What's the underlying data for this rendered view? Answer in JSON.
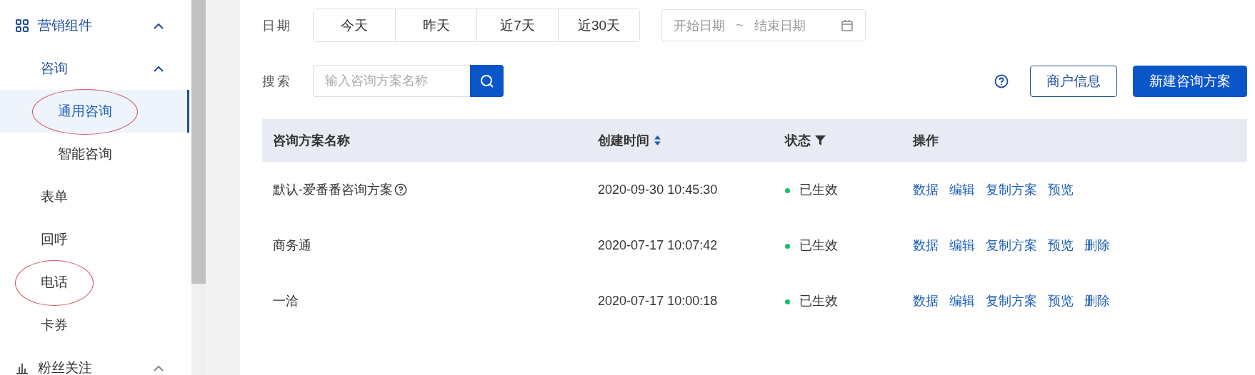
{
  "sidebar": {
    "items": [
      {
        "label": "营销组件",
        "expanded": true,
        "selected": false,
        "circled": false,
        "children": [
          {
            "label": "咨询",
            "expanded": true,
            "selected": false,
            "circled": false,
            "children": [
              {
                "label": "通用咨询",
                "selected": true,
                "circled": true
              },
              {
                "label": "智能咨询",
                "selected": false,
                "circled": false
              }
            ]
          },
          {
            "label": "表单",
            "selected": false,
            "circled": false
          },
          {
            "label": "回呼",
            "selected": false,
            "circled": false
          },
          {
            "label": "电话",
            "selected": false,
            "circled": true
          },
          {
            "label": "卡券",
            "selected": false,
            "circled": false
          }
        ]
      },
      {
        "label": "粉丝关注",
        "expanded": true,
        "selected": false,
        "circled": false
      }
    ]
  },
  "filters": {
    "date_label": "日期",
    "date_options": [
      {
        "label": "今天",
        "selected": false
      },
      {
        "label": "昨天",
        "selected": false
      },
      {
        "label": "近7天",
        "selected": false
      },
      {
        "label": "近30天",
        "selected": false
      }
    ],
    "date_range": {
      "start_placeholder": "开始日期",
      "separator": "~",
      "end_placeholder": "结束日期"
    },
    "search_label": "搜索",
    "search": {
      "placeholder": "输入咨询方案名称"
    }
  },
  "toolbar": {
    "buttons": [
      {
        "label": "商户信息",
        "kind": "outline"
      },
      {
        "label": "新建咨询方案",
        "kind": "primary"
      }
    ]
  },
  "table": {
    "columns": [
      {
        "label": "咨询方案名称",
        "kind": "plain"
      },
      {
        "label": "创建时间",
        "kind": "sort"
      },
      {
        "label": "状态",
        "kind": "filter"
      },
      {
        "label": "操作",
        "kind": "plain"
      }
    ],
    "rows": [
      {
        "name": "默认-爱番番咨询方案",
        "help": true,
        "created": "2020-09-30 10:45:30",
        "status": {
          "label": "已生效",
          "color": "#19be6b"
        },
        "actions": [
          "数据",
          "编辑",
          "复制方案",
          "预览"
        ]
      },
      {
        "name": "商务通",
        "help": false,
        "created": "2020-07-17 10:07:42",
        "status": {
          "label": "已生效",
          "color": "#19be6b"
        },
        "actions": [
          "数据",
          "编辑",
          "复制方案",
          "预览",
          "删除"
        ]
      },
      {
        "name": "一洽",
        "help": false,
        "created": "2020-07-17 10:00:18",
        "status": {
          "label": "已生效",
          "color": "#19be6b"
        },
        "actions": [
          "数据",
          "编辑",
          "复制方案",
          "预览",
          "删除"
        ]
      }
    ]
  }
}
